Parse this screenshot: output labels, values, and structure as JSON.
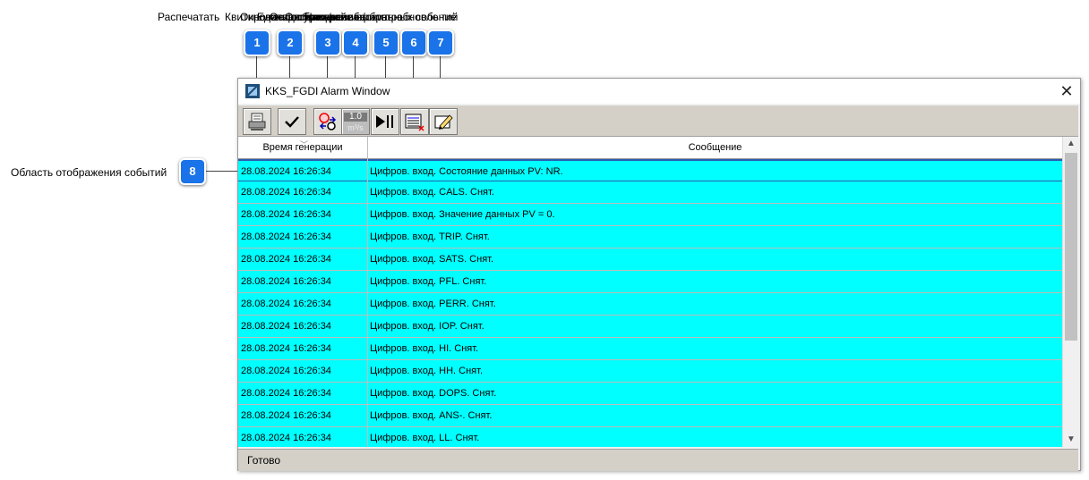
{
  "callouts": {
    "captions": [
      "Распечатать",
      "Квитировать событие",
      "Окно конфигурации",
      "Единицы измерения",
      "Остановить/возобновить обновление",
      "Отображение выбранных событий",
      "Настройки фильтра"
    ],
    "badges": [
      "1",
      "2",
      "3",
      "4",
      "5",
      "6",
      "7",
      "8"
    ],
    "area_label": "Область отображения событий"
  },
  "window": {
    "title": "KKS_FGDI Alarm Window",
    "close_symbol": "✕",
    "toolbar": {
      "print_icon": "printer-icon",
      "ack_icon": "checkmark-icon",
      "config_icon": "config-icon",
      "units_top": "1.0",
      "units_bottom": "m³/s",
      "pause_icon": "play-pause-icon",
      "events_icon": "event-list-icon",
      "filter_icon": "filter-edit-icon"
    },
    "columns": [
      "Время генерации",
      "Сообщение"
    ],
    "rows": [
      {
        "time": "28.08.2024 16:26:34",
        "msg": "Цифров. вход. Состояние данных PV: NR."
      },
      {
        "time": "28.08.2024 16:26:34",
        "msg": "Цифров. вход. CALS. Снят."
      },
      {
        "time": "28.08.2024 16:26:34",
        "msg": "Цифров. вход. Значение данных PV = 0."
      },
      {
        "time": "28.08.2024 16:26:34",
        "msg": "Цифров. вход. TRIP. Снят."
      },
      {
        "time": "28.08.2024 16:26:34",
        "msg": "Цифров. вход. SATS. Снят."
      },
      {
        "time": "28.08.2024 16:26:34",
        "msg": "Цифров. вход. PFL. Снят."
      },
      {
        "time": "28.08.2024 16:26:34",
        "msg": "Цифров. вход. PERR. Снят."
      },
      {
        "time": "28.08.2024 16:26:34",
        "msg": "Цифров. вход. IOP. Снят."
      },
      {
        "time": "28.08.2024 16:26:34",
        "msg": "Цифров. вход. HI. Снят."
      },
      {
        "time": "28.08.2024 16:26:34",
        "msg": "Цифров. вход. HH. Снят."
      },
      {
        "time": "28.08.2024 16:26:34",
        "msg": "Цифров. вход. DOPS. Снят."
      },
      {
        "time": "28.08.2024 16:26:34",
        "msg": "Цифров. вход. ANS-. Снят."
      },
      {
        "time": "28.08.2024 16:26:34",
        "msg": "Цифров. вход. LL. Снят."
      }
    ],
    "status": "Готово"
  },
  "colors": {
    "row_bg": "#00ffff",
    "badge": "#1a73e8",
    "selection": "#2a5db0"
  }
}
